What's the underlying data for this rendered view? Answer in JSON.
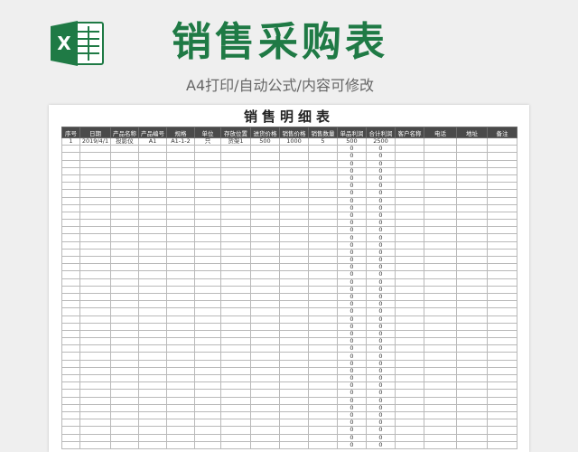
{
  "header": {
    "title": "销售采购表",
    "subtitle": "A4打印/自动公式/内容可修改",
    "logo_icon": "excel-logo-icon",
    "brand_color": "#1f7a45"
  },
  "sheet": {
    "title": "销售明细表",
    "columns": [
      "序号",
      "日期",
      "产品名称",
      "产品编号",
      "规格",
      "单位",
      "存放位置",
      "进货价格",
      "销售价格",
      "销售数量",
      "单品利润",
      "合计利润",
      "客户名称",
      "电话",
      "地址",
      "备注"
    ],
    "first_row": [
      "1",
      "2019/4/1",
      "投影仪",
      "A1",
      "A1-1-2",
      "只",
      "货架1",
      "500",
      "1000",
      "5",
      "500",
      "2500",
      "",
      "",
      "",
      ""
    ],
    "default_profit_value": "0",
    "visible_blank_rows": 41
  }
}
